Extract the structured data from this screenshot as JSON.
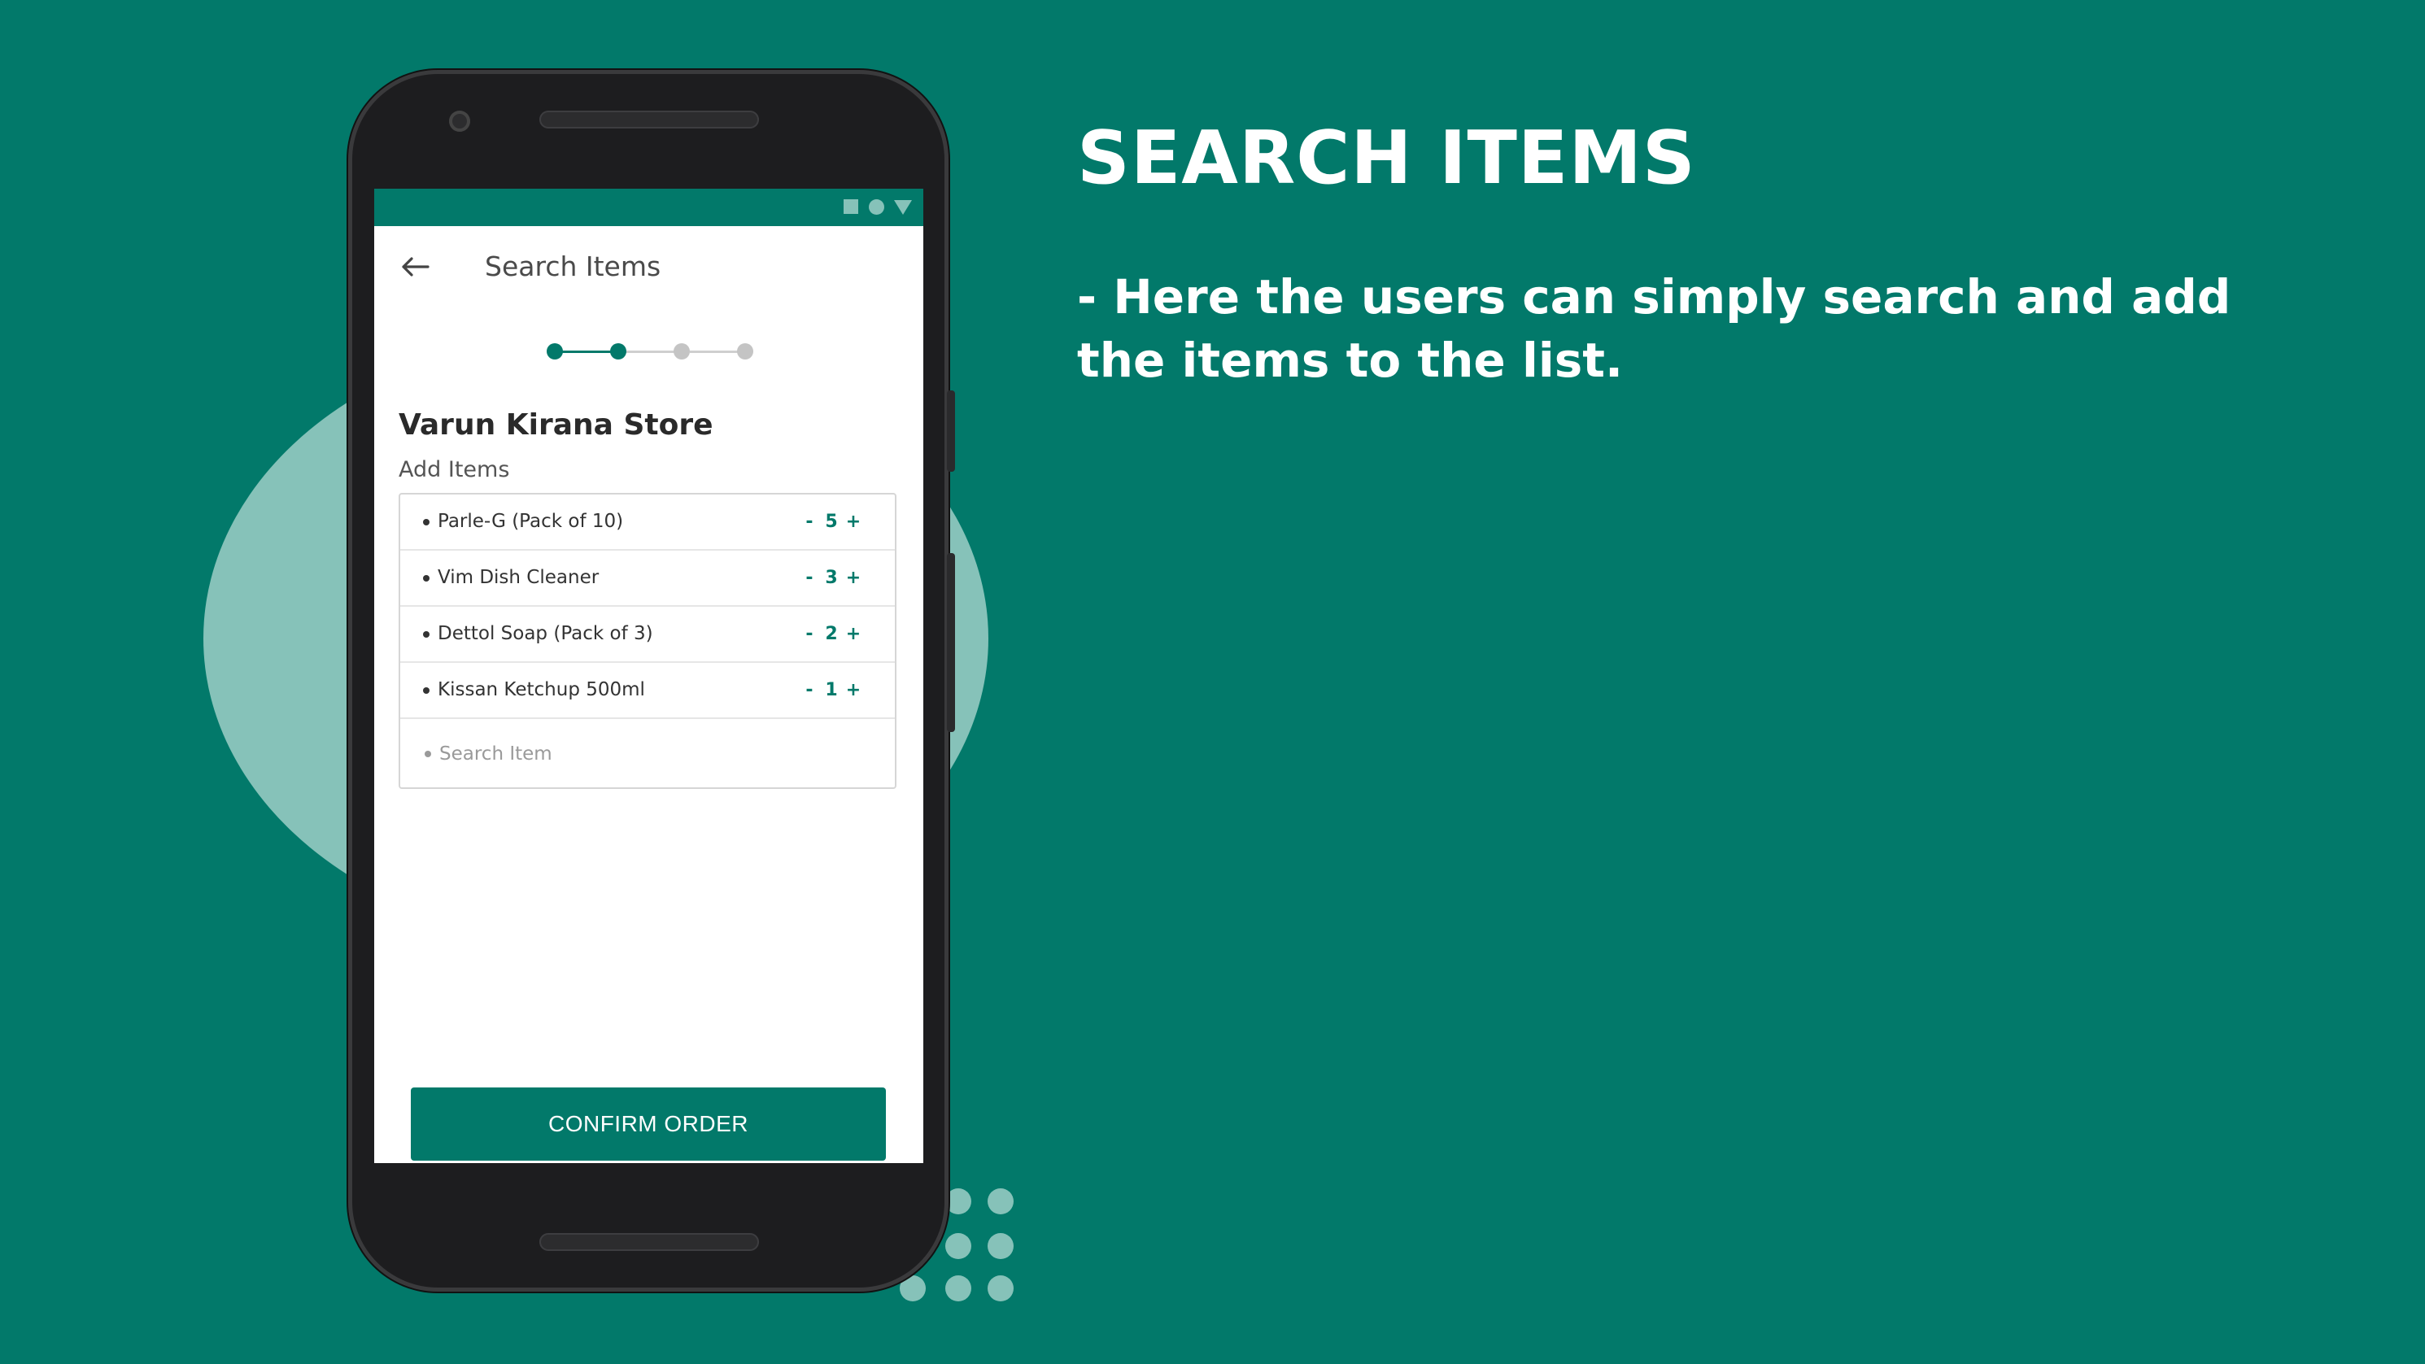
{
  "slide": {
    "title": "SEARCH ITEMS",
    "description": "- Here the users can simply search and add the items to the list."
  },
  "app": {
    "header_title": "Search Items",
    "progress": {
      "total_steps": 4,
      "current_step": 2
    },
    "store_name": "Varun Kirana Store",
    "section_label": "Add Items",
    "items": [
      {
        "name": "Parle-G (Pack of 10)",
        "quantity": "5"
      },
      {
        "name": "Vim Dish Cleaner",
        "quantity": "3"
      },
      {
        "name": "Dettol Soap (Pack of 3)",
        "quantity": "2"
      },
      {
        "name": "Kissan Ketchup 500ml",
        "quantity": "1"
      }
    ],
    "qty_minus": "-",
    "qty_plus": "+",
    "search_placeholder": "Search Item",
    "search_value": "",
    "confirm_label": "CONFIRM ORDER"
  },
  "icons": {
    "back": "arrow-left-icon",
    "status": [
      "square-icon",
      "circle-icon",
      "triangle-icon"
    ]
  },
  "colors": {
    "background": "#02796a",
    "accent": "#02796a",
    "decor": "#86c2b9",
    "step_active": "#02796a",
    "step_inactive": "#c4c4c4"
  }
}
